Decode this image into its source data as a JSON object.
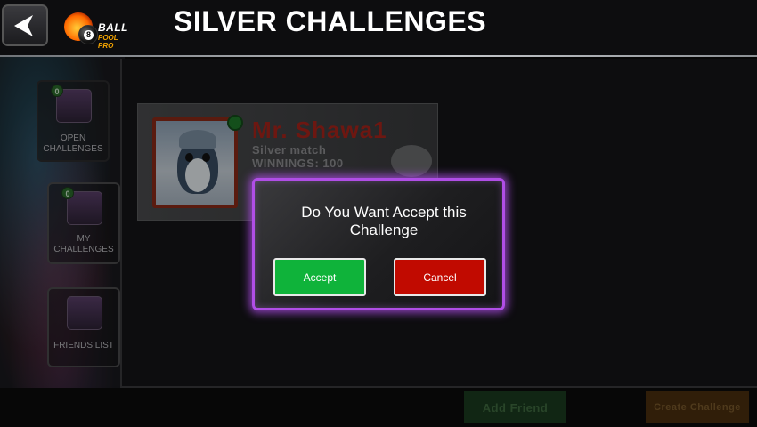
{
  "header": {
    "title": "SILVER CHALLENGES",
    "back_icon": "back-arrow-icon",
    "logo": {
      "line1": "BALL",
      "line2": "POOL PRO",
      "ball_number": "8"
    }
  },
  "sidebar": {
    "items": [
      {
        "label": "OPEN CHALLENGES",
        "badge": "0",
        "icon": "open-challenges-icon"
      },
      {
        "label": "MY CHALLENGES",
        "badge": "0",
        "icon": "my-challenges-icon"
      },
      {
        "label": "FRIENDS LIST",
        "icon": "friends-list-icon"
      }
    ]
  },
  "challenge": {
    "player_name": "Mr. Shawa1",
    "match_type": "Silver match",
    "winnings": "WINNINGS: 100",
    "status_color": "#1f7a2a"
  },
  "footer": {
    "add_friend_label": "Add Friend",
    "create_challenge_label": "Create Challenge"
  },
  "dialog": {
    "message": "Do You Want Accept this Challenge",
    "accept_label": "Accept",
    "cancel_label": "Cancel",
    "accent_color": "#b04ee6",
    "accept_color": "#0fb33a",
    "cancel_color": "#c10a00"
  }
}
